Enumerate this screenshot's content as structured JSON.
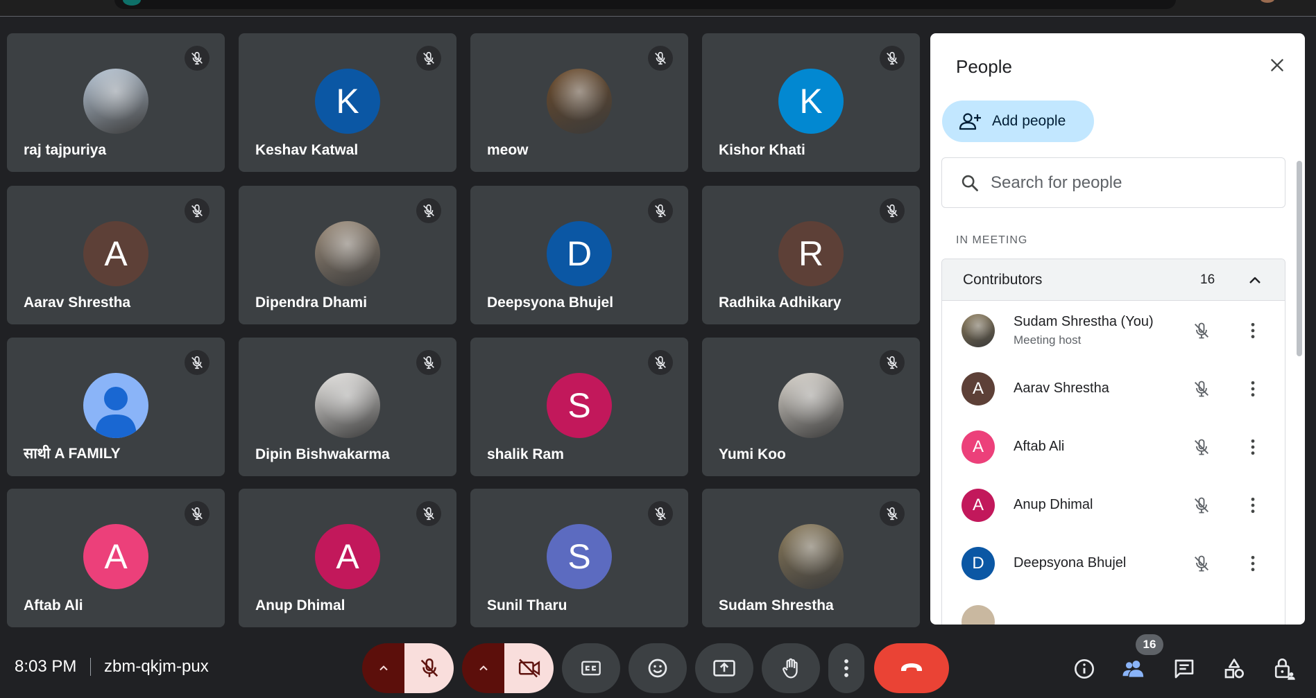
{
  "meeting": {
    "time": "8:03 PM",
    "code": "zbm-qkjm-pux"
  },
  "tiles": [
    {
      "name": "raj tajpuriya",
      "avatar_type": "photo",
      "avatar_bg": "#b7c6d6"
    },
    {
      "name": "Keshav Katwal",
      "avatar_type": "letter",
      "letter": "K",
      "avatar_bg": "#0b57a4"
    },
    {
      "name": "meow",
      "avatar_type": "photo",
      "avatar_bg": "#6b4a2a"
    },
    {
      "name": "Kishor Khati",
      "avatar_type": "letter",
      "letter": "K",
      "avatar_bg": "#0288d1"
    },
    {
      "name": "Aarav Shrestha",
      "avatar_type": "letter",
      "letter": "A",
      "avatar_bg": "#5d4037"
    },
    {
      "name": "Dipendra Dhami",
      "avatar_type": "photo",
      "avatar_bg": "#9c8c7a"
    },
    {
      "name": "Deepsyona Bhujel",
      "avatar_type": "letter",
      "letter": "D",
      "avatar_bg": "#0b57a4"
    },
    {
      "name": "Radhika Adhikary",
      "avatar_type": "letter",
      "letter": "R",
      "avatar_bg": "#5d4037"
    },
    {
      "name": "साथी A FAMILY",
      "avatar_type": "default-person",
      "avatar_bg": "#8ab4f8"
    },
    {
      "name": "Dipin Bishwakarma",
      "avatar_type": "photo",
      "avatar_bg": "#e8e6e3"
    },
    {
      "name": "shalik Ram",
      "avatar_type": "letter",
      "letter": "S",
      "avatar_bg": "#c2185b"
    },
    {
      "name": "Yumi Koo",
      "avatar_type": "photo",
      "avatar_bg": "#d9d4cc"
    },
    {
      "name": "Aftab Ali",
      "avatar_type": "letter",
      "letter": "A",
      "avatar_bg": "#ec407a"
    },
    {
      "name": "Anup Dhimal",
      "avatar_type": "letter",
      "letter": "A",
      "avatar_bg": "#c2185b"
    },
    {
      "name": "Sunil Tharu",
      "avatar_type": "letter",
      "letter": "S",
      "avatar_bg": "#5c6bc0"
    },
    {
      "name": "Sudam Shrestha",
      "avatar_type": "photo",
      "avatar_bg": "#8a7a5a"
    }
  ],
  "panel": {
    "title": "People",
    "add_people": "Add people",
    "search_placeholder": "Search for people",
    "in_meeting": "IN MEETING",
    "contributors_label": "Contributors",
    "contributors_count": "16",
    "people": [
      {
        "name": "Sudam Shrestha (You)",
        "subtitle": "Meeting host",
        "avatar_type": "photo",
        "avatar_bg": "#8a7a5a"
      },
      {
        "name": "Aarav Shrestha",
        "letter": "A",
        "avatar_type": "letter",
        "avatar_bg": "#5d4037"
      },
      {
        "name": "Aftab Ali",
        "letter": "A",
        "avatar_type": "letter",
        "avatar_bg": "#ec407a"
      },
      {
        "name": "Anup Dhimal",
        "letter": "A",
        "avatar_type": "letter",
        "avatar_bg": "#c2185b"
      },
      {
        "name": "Deepsyona Bhujel",
        "letter": "D",
        "avatar_type": "letter",
        "avatar_bg": "#0b57a4"
      }
    ]
  },
  "toolbar": {
    "people_badge": "16"
  },
  "colors": {
    "end_call": "#ea4335",
    "muted_bg": "#f9dedc",
    "accent_chip": "#c2e7ff"
  }
}
